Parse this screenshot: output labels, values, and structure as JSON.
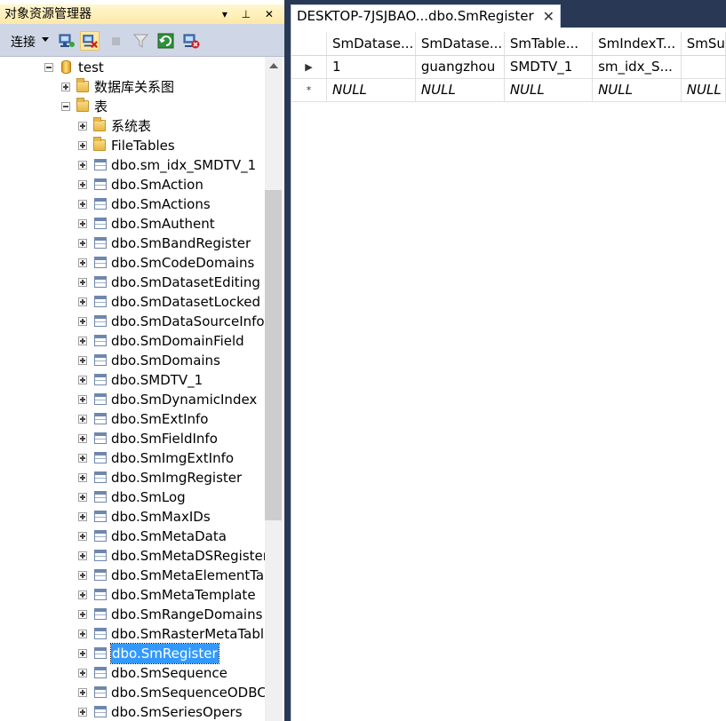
{
  "explorer": {
    "title": "对象资源管理器",
    "title_buttons": "▾ ⊥ ✕",
    "toolbar": {
      "connect_label": "连接",
      "buttons": [
        "connect-object-explorer-icon",
        "disconnect-icon",
        "stop-icon",
        "filter-icon",
        "refresh-icon",
        "close-connection-icon"
      ]
    },
    "tree": {
      "database": "test",
      "folders": [
        "数据库关系图",
        "表",
        "系统表",
        "FileTables"
      ],
      "tables": [
        "dbo.sm_idx_SMDTV_1",
        "dbo.SmAction",
        "dbo.SmActions",
        "dbo.SmAuthent",
        "dbo.SmBandRegister",
        "dbo.SmCodeDomains",
        "dbo.SmDatasetEditing",
        "dbo.SmDatasetLocked",
        "dbo.SmDataSourceInfo",
        "dbo.SmDomainField",
        "dbo.SmDomains",
        "dbo.SMDTV_1",
        "dbo.SmDynamicIndex",
        "dbo.SmExtInfo",
        "dbo.SmFieldInfo",
        "dbo.SmImgExtInfo",
        "dbo.SmImgRegister",
        "dbo.SmLog",
        "dbo.SmMaxIDs",
        "dbo.SmMetaData",
        "dbo.SmMetaDSRegister",
        "dbo.SmMetaElementTa",
        "dbo.SmMetaTemplate",
        "dbo.SmRangeDomains",
        "dbo.SmRasterMetaTabl",
        "dbo.SmRegister",
        "dbo.SmSequence",
        "dbo.SmSequenceODBC",
        "dbo.SmSeriesOpers"
      ],
      "selected": "dbo.SmRegister"
    }
  },
  "document": {
    "tab_title": "DESKTOP-7JSJBAO...dbo.SmRegister",
    "tab_close": "✕",
    "grid": {
      "columns": [
        "SmDatase...",
        "SmDatase...",
        "SmTable...",
        "SmIndexT...",
        "SmSu"
      ],
      "rows": [
        {
          "marker": "▶",
          "cells": [
            "1",
            "guangzhou",
            "SMDTV_1",
            "sm_idx_S...",
            ""
          ]
        },
        {
          "marker": "*",
          "cells": [
            "NULL",
            "NULL",
            "NULL",
            "NULL",
            "NULL"
          ]
        }
      ]
    }
  },
  "colors": {
    "background": "#293955",
    "title_bar": "#ffe8a6",
    "toolbar": "#cfd6e5",
    "selection": "#3399ff"
  }
}
